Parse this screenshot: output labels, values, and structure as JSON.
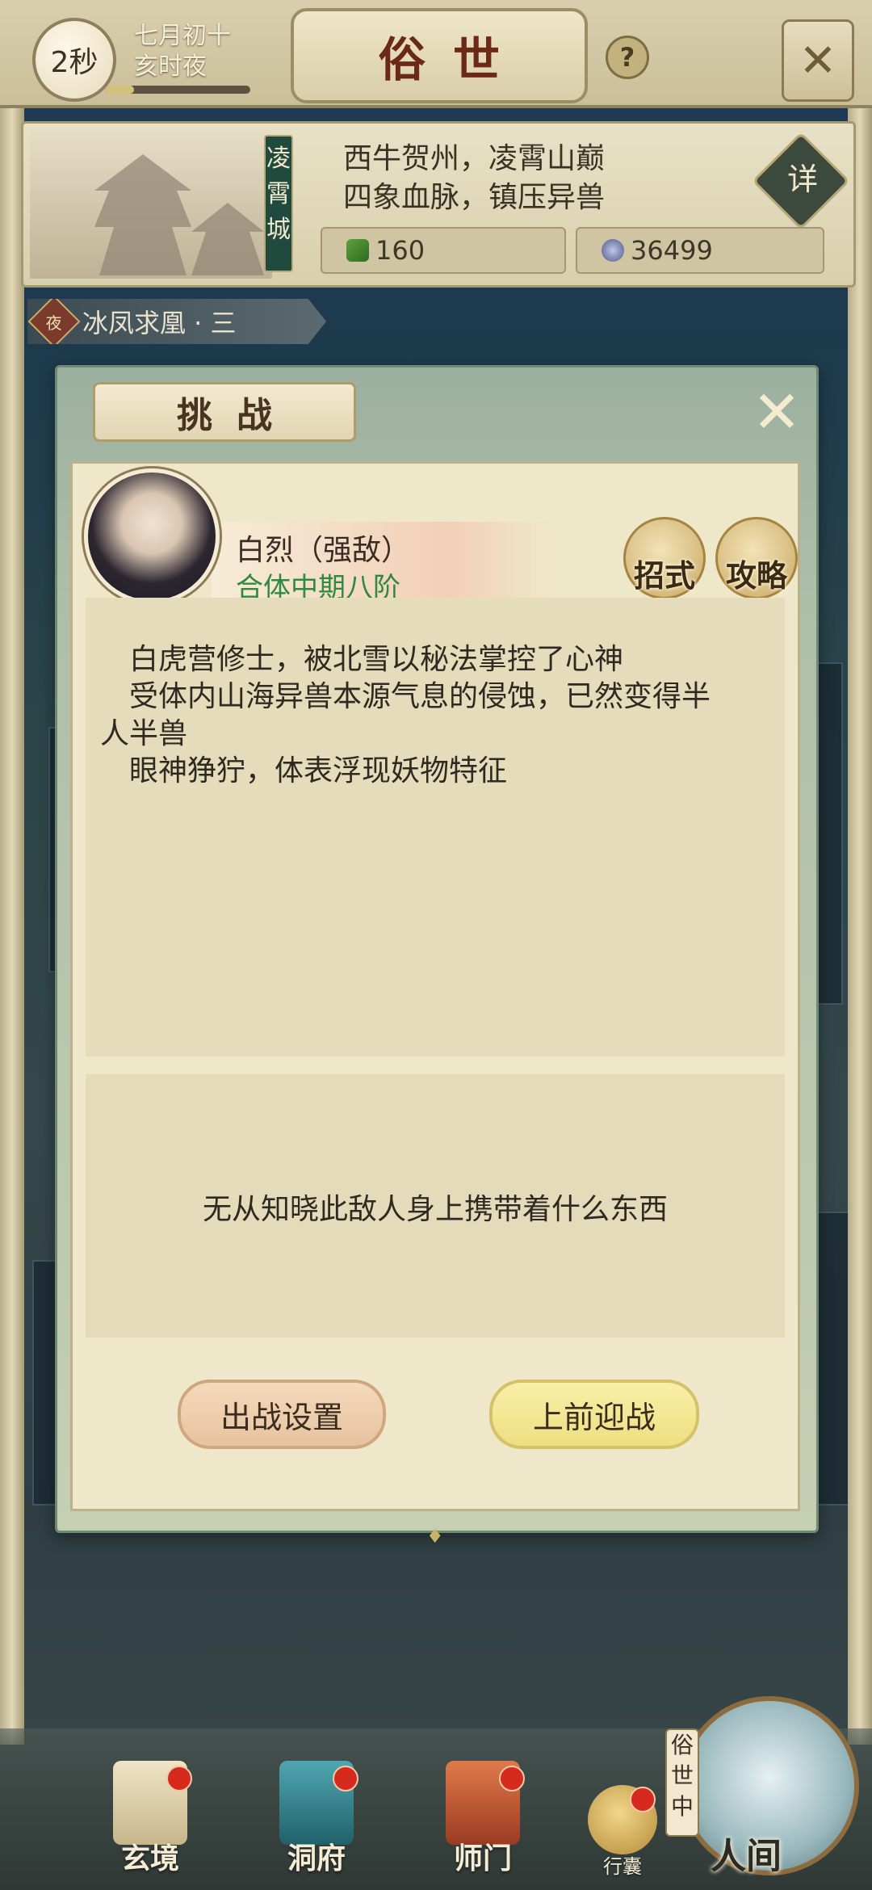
{
  "header": {
    "timer": "2秒",
    "date_line1": "七月初十",
    "date_line2": "亥时夜",
    "title": "俗世",
    "help_label": "?",
    "close_label": "✕"
  },
  "location": {
    "name_banner": "凌霄城",
    "desc_line1": "西牛贺州，凌霄山巅",
    "desc_line2": "四象血脉，镇压异兽",
    "detail_label": "详",
    "resource_1": "160",
    "resource_2": "36499",
    "resource_1_icon": "spirit-stone-icon",
    "resource_2_icon": "coin-icon"
  },
  "chapter": {
    "badge": "夜",
    "label": "冰凤求凰 · 三"
  },
  "dialog": {
    "title": "挑战",
    "close_label": "✕",
    "enemy_name": "白烈（强敌）",
    "enemy_rank": "合体中期八阶",
    "skill_btn": "招式",
    "guide_btn": "攻略",
    "description": [
      "白虎营修士，被北雪以秘法掌控了心神",
      "受体内山海异兽本源气息的侵蚀，已然变得半",
      "人半兽",
      "眼神狰狞，体表浮现妖物特征"
    ],
    "loot_text": "无从知晓此敌人身上携带着什么东西",
    "setup_btn": "出战设置",
    "fight_btn": "上前迎战"
  },
  "nav": {
    "items": [
      "玄境",
      "洞府",
      "师门"
    ],
    "bag_label": "行囊",
    "world_tag": "俗世中",
    "world_label": "人间"
  },
  "colors": {
    "rank_green": "#2f8a3f",
    "title_red": "#6b2a18",
    "notification_red": "#d62a1f"
  }
}
